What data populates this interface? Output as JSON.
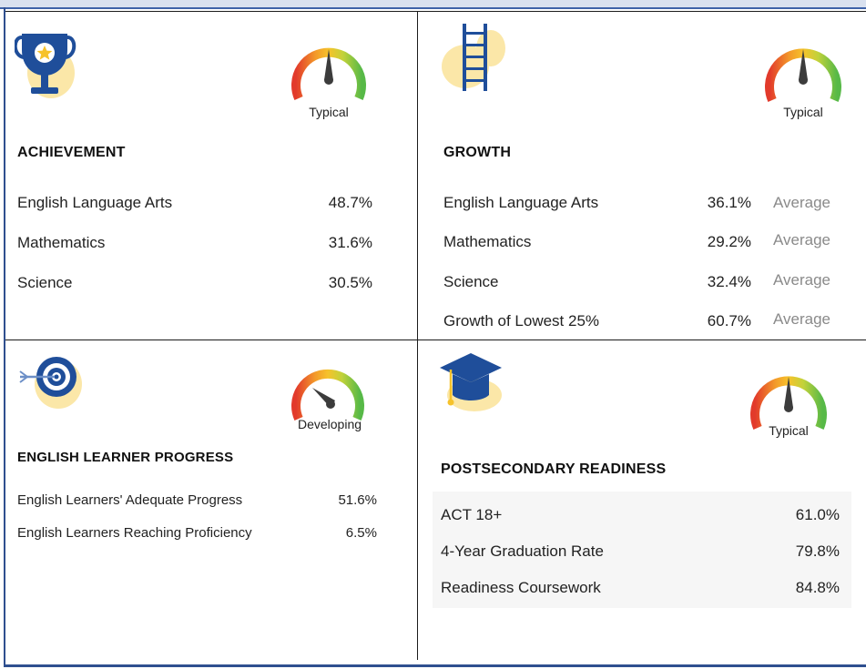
{
  "panels": {
    "achievement": {
      "title": "ACHIEVEMENT",
      "icon": "trophy-icon",
      "gauge_label": "Typical",
      "rows": [
        {
          "label": "English Language Arts",
          "value": "48.7%"
        },
        {
          "label": "Mathematics",
          "value": "31.6%"
        },
        {
          "label": "Science",
          "value": "30.5%"
        }
      ]
    },
    "growth": {
      "title": "GROWTH",
      "icon": "ladder-icon",
      "gauge_label": "Typical",
      "rows": [
        {
          "label": "English Language Arts",
          "value": "36.1%",
          "note": "Average"
        },
        {
          "label": "Mathematics",
          "value": "29.2%",
          "note": "Average"
        },
        {
          "label": "Science",
          "value": "32.4%",
          "note": "Average"
        },
        {
          "label": "Growth of Lowest 25%",
          "value": "60.7%",
          "note": "Average"
        }
      ]
    },
    "english_learner": {
      "title": "ENGLISH LEARNER PROGRESS",
      "icon": "target-icon",
      "gauge_label": "Developing",
      "rows": [
        {
          "label": "English Learners' Adequate Progress",
          "value": "51.6%"
        },
        {
          "label": "English Learners Reaching Proficiency",
          "value": "6.5%"
        }
      ]
    },
    "postsecondary": {
      "title": "POSTSECONDARY READINESS",
      "icon": "graduation-cap-icon",
      "gauge_label": "Typical",
      "rows": [
        {
          "label": "ACT 18+",
          "value": "61.0%"
        },
        {
          "label": "4-Year Graduation Rate",
          "value": "79.8%"
        },
        {
          "label": "Readiness Coursework",
          "value": "84.8%"
        }
      ]
    }
  },
  "colors": {
    "icon_blue": "#1f4e9a",
    "icon_blob": "#fbe7a8",
    "gauge_red": "#e23a2b",
    "gauge_yellow": "#f6c22b",
    "gauge_green": "#57b947",
    "needle": "#3c3c3c"
  }
}
